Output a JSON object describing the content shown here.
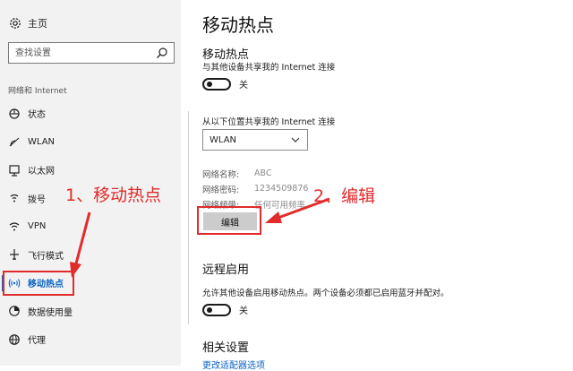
{
  "sidebar": {
    "home_label": "主页",
    "search_placeholder": "查找设置",
    "section_label": "网络和 Internet",
    "items": [
      {
        "label": "状态",
        "icon": "status-icon"
      },
      {
        "label": "WLAN",
        "icon": "wifi-icon"
      },
      {
        "label": "以太网",
        "icon": "ethernet-icon"
      },
      {
        "label": "拨号",
        "icon": "dialup-icon"
      },
      {
        "label": "VPN",
        "icon": "vpn-icon"
      },
      {
        "label": "飞行模式",
        "icon": "airplane-icon"
      },
      {
        "label": "移动热点",
        "icon": "hotspot-icon",
        "active": true
      },
      {
        "label": "数据使用量",
        "icon": "data-usage-icon"
      },
      {
        "label": "代理",
        "icon": "globe-icon"
      }
    ]
  },
  "main": {
    "page_title": "移动热点",
    "hotspot": {
      "title": "移动热点",
      "description": "与其他设备共享我的 Internet 连接",
      "toggle_label": "关"
    },
    "share_from": {
      "label": "从以下位置共享我的 Internet 连接",
      "selected": "WLAN"
    },
    "network_info": [
      {
        "key": "网络名称:",
        "value": "ABC"
      },
      {
        "key": "网络密码:",
        "value": "1234509876"
      },
      {
        "key": "网络频带:",
        "value": "任何可用频率"
      }
    ],
    "edit_button": "编辑",
    "remote": {
      "title": "远程启用",
      "description": "允许其他设备启用移动热点。两个设备必须都已启用蓝牙并配对。",
      "toggle_label": "关"
    },
    "related": {
      "title": "相关设置",
      "link": "更改适配器选项"
    }
  },
  "annotations": {
    "step1": "1、移动热点",
    "step2": "2、编辑",
    "color": "#e22b2b"
  },
  "colors": {
    "accent": "#0a63c4",
    "sidebar_bg": "#f2f2f2",
    "annotation_red": "#e22b2b"
  }
}
